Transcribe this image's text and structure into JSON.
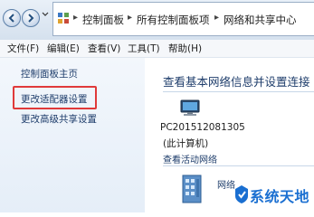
{
  "address_bar": {
    "breadcrumbs": [
      "控制面板",
      "所有控制面板项",
      "网络和共享中心"
    ]
  },
  "menu": {
    "items": [
      "文件(F)",
      "编辑(E)",
      "查看(V)",
      "工具(T)",
      "帮助(H)"
    ]
  },
  "left_pane": {
    "links": [
      "控制面板主页",
      "更改适配器设置",
      "更改高级共享设置"
    ]
  },
  "main": {
    "title": "查看基本网络信息并设置连接",
    "computer_name": "PC201512081305",
    "computer_caption": "(此计算机)",
    "active_networks_label": "查看活动网络",
    "network_name": "网络"
  },
  "watermark": {
    "text": "系统天地"
  },
  "colors": {
    "highlight_border": "#e03a3a",
    "link": "#1e3d6b",
    "watermark": "#1a6fd1"
  }
}
